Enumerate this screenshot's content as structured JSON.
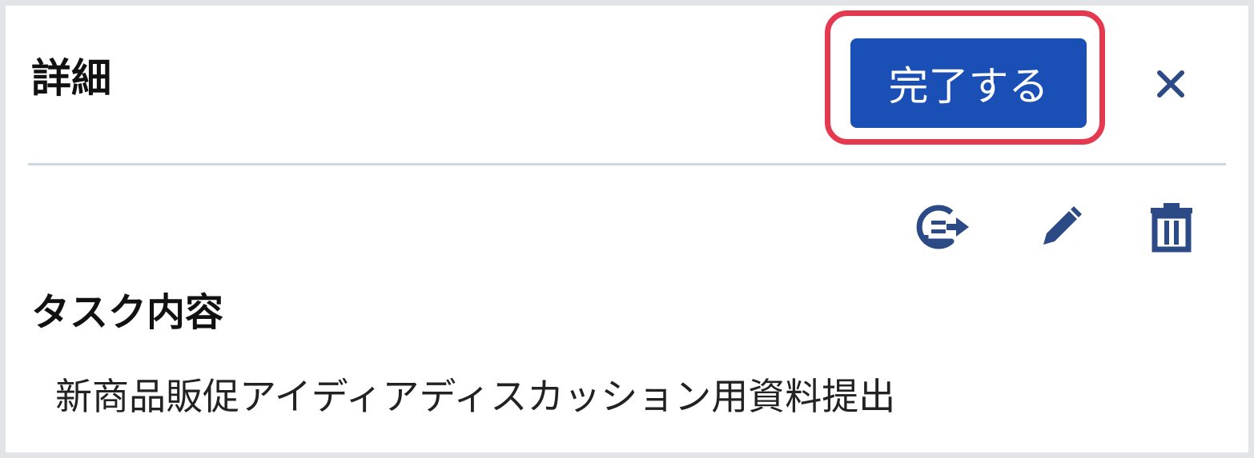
{
  "header": {
    "title": "詳細",
    "complete_label": "完了する",
    "close_glyph": "✕"
  },
  "toolbar": {
    "items": [
      {
        "name": "move-task",
        "icon": "message-arrow-icon"
      },
      {
        "name": "edit",
        "icon": "pencil-icon"
      },
      {
        "name": "delete",
        "icon": "trash-icon"
      }
    ]
  },
  "task": {
    "section_label": "タスク内容",
    "content": "新商品販促アイディアディスカッション用資料提出"
  },
  "colors": {
    "primary": "#1a4fb5",
    "icon": "#2b4a86",
    "highlight": "#e5394f",
    "divider": "#cdd8e4"
  }
}
